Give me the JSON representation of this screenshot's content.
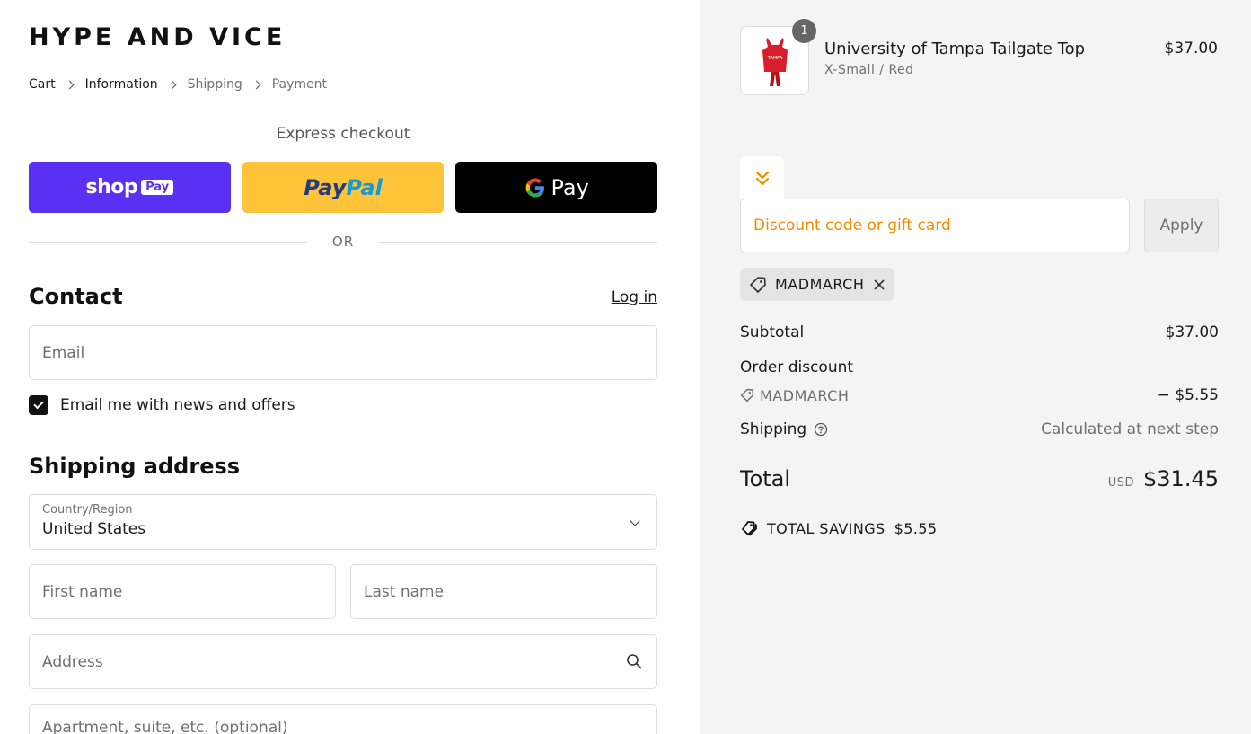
{
  "brand": "HYPE AND VICE",
  "breadcrumb": {
    "cart": "Cart",
    "information": "Information",
    "shipping": "Shipping",
    "payment": "Payment"
  },
  "express": {
    "title": "Express checkout",
    "shop_word": "shop",
    "shop_pay": "Pay",
    "paypal_a": "Pay",
    "paypal_b": "Pal",
    "gpay_g": "G",
    "gpay_pay": "Pay",
    "or": "OR"
  },
  "contact": {
    "title": "Contact",
    "login": "Log in",
    "email_placeholder": "Email",
    "newsletter_label": "Email me with news and offers",
    "newsletter_checked": true
  },
  "shipping_address": {
    "title": "Shipping address",
    "country_label": "Country/Region",
    "country_value": "United States",
    "first_name_placeholder": "First name",
    "last_name_placeholder": "Last name",
    "address_placeholder": "Address",
    "apartment_placeholder": "Apartment, suite, etc. (optional)"
  },
  "order": {
    "product": {
      "name": "University of Tampa Tailgate Top",
      "variant": "X-Small / Red",
      "price": "$37.00",
      "quantity": "1",
      "thumb_text": "TAMPA"
    },
    "discount_placeholder": "Discount code or gift card",
    "apply_label": "Apply",
    "applied_code": "MADMARCH",
    "subtotal_label": "Subtotal",
    "subtotal_value": "$37.00",
    "order_discount_label": "Order discount",
    "discount_code": "MADMARCH",
    "discount_value": "− $5.55",
    "shipping_label": "Shipping",
    "shipping_value": "Calculated at next step",
    "total_label": "Total",
    "total_currency": "USD",
    "total_value": "$31.45",
    "savings_label": "TOTAL SAVINGS",
    "savings_value": "$5.55"
  },
  "colors": {
    "shop_pay": "#5a31f4",
    "paypal": "#ffc439",
    "gpay": "#000000",
    "discount_accent": "#f08c00"
  }
}
